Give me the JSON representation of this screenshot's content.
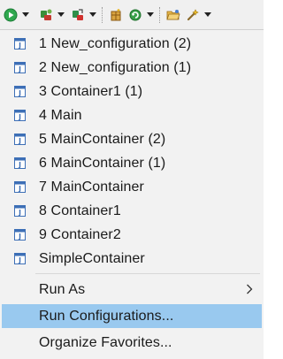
{
  "toolbar": {
    "buttons": [
      {
        "icon": "run-icon",
        "has_dropdown": true
      },
      {
        "icon": "coverage-icon",
        "has_dropdown": true
      },
      {
        "icon": "external-tools-icon",
        "has_dropdown": true
      },
      {
        "icon": "new-package-icon",
        "has_dropdown": false
      },
      {
        "icon": "refresh-icon",
        "has_dropdown": true
      },
      {
        "icon": "open-folder-icon",
        "has_dropdown": false
      },
      {
        "icon": "wand-icon",
        "has_dropdown": true
      }
    ]
  },
  "menu": {
    "history": [
      {
        "label": "1 New_configuration (2)",
        "icon": "java-app-icon"
      },
      {
        "label": "2 New_configuration (1)",
        "icon": "java-app-icon"
      },
      {
        "label": "3 Container1 (1)",
        "icon": "java-app-icon"
      },
      {
        "label": "4 Main",
        "icon": "java-app-icon"
      },
      {
        "label": "5 MainContainer (2)",
        "icon": "java-app-icon"
      },
      {
        "label": "6 MainContainer (1)",
        "icon": "java-app-icon"
      },
      {
        "label": "7 MainContainer",
        "icon": "java-app-icon"
      },
      {
        "label": "8 Container1",
        "icon": "java-app-icon"
      },
      {
        "label": "9 Container2",
        "icon": "java-app-icon"
      },
      {
        "label": "SimpleContainer",
        "icon": "java-app-icon"
      }
    ],
    "run_as": "Run As",
    "run_configurations": "Run Configurations...",
    "organize_favorites": "Organize Favorites..."
  },
  "colors": {
    "highlight": "#99c9ef",
    "menu_bg": "#f2f2f2"
  }
}
